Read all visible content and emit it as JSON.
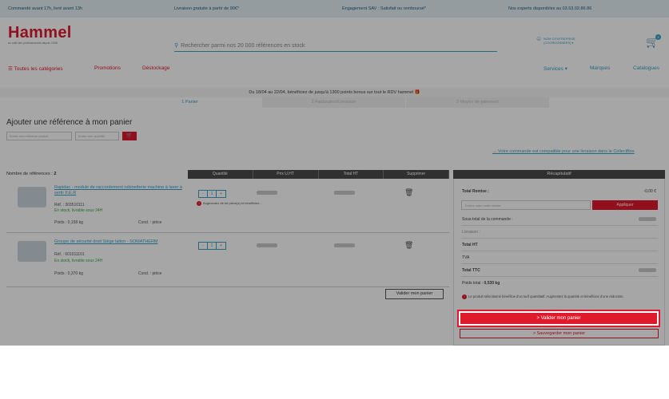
{
  "topbar": {
    "order": "Commandé avant 17h, livré avant 13h",
    "shipping": "Livraison gratuite à partir de 90€*",
    "sav": "Engagement SAV : Satisfait ou remboursé*",
    "experts": "Nos experts disponibles au 03.53.02.86.86"
  },
  "header": {
    "logo": "Hammel",
    "logo_sub": "au côté des professionnels depuis 1948",
    "search_placeholder": "Rechercher parmi nos 20 000 références en stock",
    "account_line1": "NOM D'ENTREPRISE",
    "account_line2": "(COORDONNÉES) ▾",
    "cart_count": "2"
  },
  "nav": {
    "categories": "☰ Toutes les catégories",
    "promotions": "Promotions",
    "destockage": "Déstockage",
    "services": "Services ▾",
    "marques": "Marques",
    "catalogues": "Catalogues"
  },
  "promo_banner": "Du 18/04 au 22/04, bénéficiez de jusqu'à 1300 points bonus sur tout le RDV hammel 🎁",
  "steps": [
    "1 Panier",
    "2 Facturation/Livraison",
    "3 Moyen de paiement"
  ],
  "add_ref": {
    "title": "Ajouter une référence à mon panier",
    "ref_placeholder": "Entrez une référence produit",
    "qty_placeholder": "Entrez une quantité",
    "cart_icon": "🛒"
  },
  "collect_link": "→ Votre commande est compatible pour une livraison dans le CollectBox",
  "table": {
    "nb_refs_label": "Nombre de références :",
    "nb_refs": "2",
    "headers": [
      "Quantité",
      "Prix U.HT",
      "Total HT",
      "Supprimer"
    ]
  },
  "items": [
    {
      "name": "Rapidac - module de raccordement robinetterie machine à laver à sertir F.E.R",
      "ref": "Réf. : 303510111",
      "stock": "En stock, livrable sous 24H",
      "weight": "Poids : 0,158 kg",
      "cond": "Cond. : pièce",
      "qty": "1",
      "warning": "Augmentez de ## pièce(s) et bénéficiez..."
    },
    {
      "name": "Groupe de sécurité droit Siège laiton - SOMATHERM",
      "ref": "Réf. : 601011101",
      "stock": "En stock, livrable sous 24H",
      "weight": "Poids : 0,370 kg",
      "cond": "Cond. : pièce",
      "qty": "1"
    }
  ],
  "validate_small": "Valider mon panier",
  "summary": {
    "title": "Récapitulatif",
    "remise_label": "Total Remise :",
    "remise_value": "-0,00 €",
    "promo_placeholder": "Entrez votre code remise",
    "apply": "Appliquer",
    "subtotal_label": "Sous-total de la commande :",
    "delivery_label": "Livraison :",
    "total_ht_label": "Total HT",
    "tva_label": "TVA",
    "total_ttc_label": "Total TTC",
    "weight_label": "Poids total :",
    "weight_value": "0,530 kg",
    "warning": "Le produit sélectionné bénéficie d'un tarif quantitatif. Augmentez la quantité et bénéficiez d'une réduction.",
    "validate": "> Valider mon panier",
    "save": "> Sauvegarder mon panier"
  }
}
